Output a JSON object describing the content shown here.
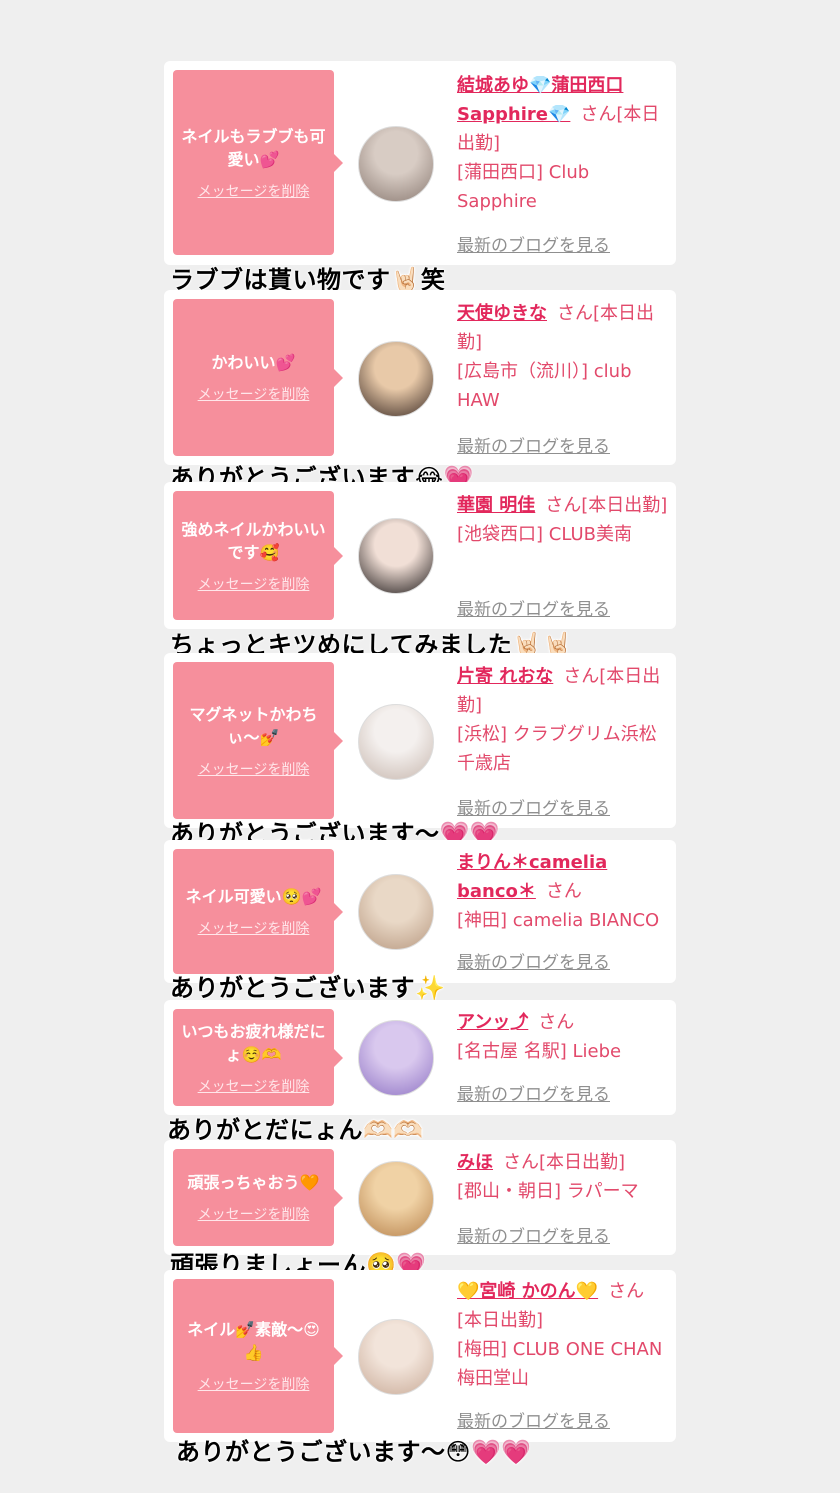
{
  "entries": [
    {
      "message": "ネイルもラブブも可愛い💕",
      "delete_label": "メッセージを削除",
      "name": "結城あゆ💎蒲田西口Sapphire💎",
      "san": "さん",
      "status": "[本日出勤]",
      "shop": "[蒲田西口] Club Sapphire",
      "blog_label": "最新のブログを見る",
      "caption": "ラブブは貰い物です🤘🏻笑",
      "avatar_colors": [
        "#d8ccc4",
        "#8a7a72"
      ]
    },
    {
      "message": "かわいい💕",
      "delete_label": "メッセージを削除",
      "name": "天使ゆきな",
      "san": "さん",
      "status": "[本日出勤]",
      "shop": "[広島市（流川）] club HAW",
      "blog_label": "最新のブログを見る",
      "caption": "ありがとうございます😂💗",
      "avatar_colors": [
        "#e8c9a8",
        "#3a2a24"
      ]
    },
    {
      "message": "強めネイルかわいいです🥰",
      "delete_label": "メッセージを削除",
      "name": "華園 明佳",
      "san": "さん",
      "status": "[本日出勤]",
      "shop": "[池袋西口] CLUB美南",
      "blog_label": "最新のブログを見る",
      "caption": "ちょっとキツめにしてみました🤘🏻🤘🏻",
      "avatar_colors": [
        "#f1dfd6",
        "#1f1a1a"
      ]
    },
    {
      "message": "マグネットかわちぃ〜💅",
      "delete_label": "メッセージを削除",
      "name": "片寄 れおな",
      "san": "さん",
      "status": "[本日出勤]",
      "shop": "[浜松] クラブグリム浜松千歳店",
      "blog_label": "最新のブログを見る",
      "caption": "ありがとうございます〜💗💗",
      "avatar_colors": [
        "#f4f0ee",
        "#c7b7ae"
      ]
    },
    {
      "message": "ネイル可愛い🥺💕",
      "delete_label": "メッセージを削除",
      "name": "まりん＊camelia banco＊",
      "san": "さん",
      "status": "",
      "shop": "[神田] camelia BIANCO",
      "blog_label": "最新のブログを見る",
      "caption": "ありがとうございます✨",
      "avatar_colors": [
        "#e9d8c6",
        "#b79880"
      ]
    },
    {
      "message": "いつもお疲れ様だにょ☺️🫶",
      "delete_label": "メッセージを削除",
      "name": "アンッ⤴︎",
      "san": "さん",
      "status": "",
      "shop": "[名古屋 名駅] Liebe",
      "blog_label": "最新のブログを見る",
      "caption": "ありがとだにょん🫶🏻🫶🏻",
      "avatar_colors": [
        "#d9c8ee",
        "#8f74c4"
      ]
    },
    {
      "message": "頑張っちゃおう🧡",
      "delete_label": "メッセージを削除",
      "name": "みほ",
      "san": "さん",
      "status": "[本日出勤]",
      "shop": "[郡山・朝日] ラパーマ",
      "blog_label": "最新のブログを見る",
      "caption": "頑張りましょーん🥺💗",
      "avatar_colors": [
        "#f0d2a5",
        "#b7824c"
      ]
    },
    {
      "message": "ネイル💅素敵〜😍👍",
      "delete_label": "メッセージを削除",
      "name": "💛宮崎 かのん💛",
      "san": "さん",
      "status": "[本日出勤]",
      "shop": "[梅田] CLUB ONE CHAN 梅田堂山",
      "blog_label": "最新のブログを見る",
      "caption": "ありがとうございます〜😳💗💗",
      "avatar_colors": [
        "#f2e4da",
        "#c9ab98"
      ]
    }
  ]
}
